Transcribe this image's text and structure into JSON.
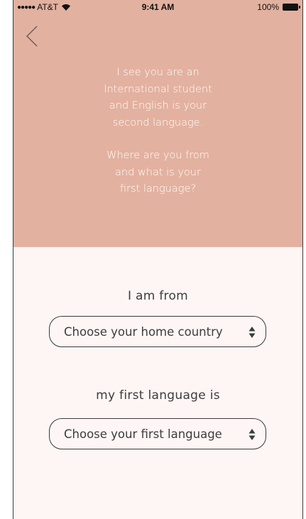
{
  "status_bar": {
    "signal": "●●●●●",
    "carrier": "AT&T",
    "time": "9:41 AM",
    "battery": "100%"
  },
  "header": {
    "back_icon": "chevron-left-icon",
    "message_lines_1": [
      "I see you are an",
      "International student",
      "and English is your",
      "second language."
    ],
    "message_lines_2": [
      "Where are you from",
      "and what is your",
      "first language?"
    ]
  },
  "form": {
    "country_label": "I am from",
    "country_select": "Choose your home country",
    "language_label": "my first language is",
    "language_select": "Choose your first language"
  },
  "colors": {
    "header_bg": "#e3b19f",
    "body_bg": "#fdf6f4",
    "text": "#3d3d3d"
  }
}
